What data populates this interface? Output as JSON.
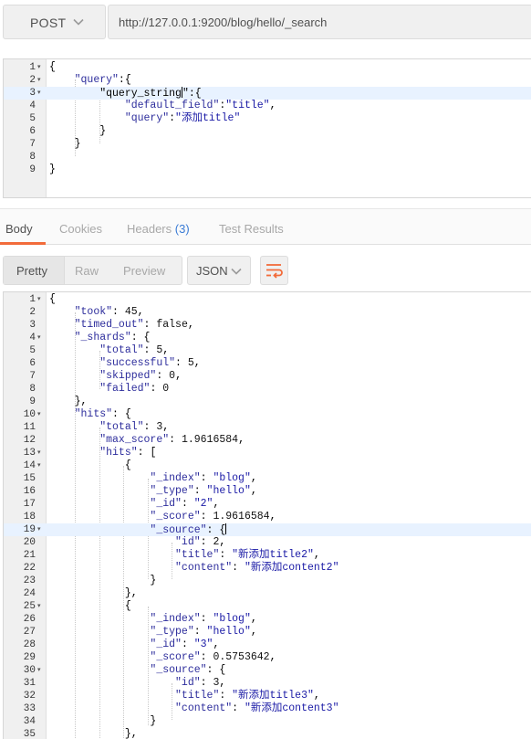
{
  "request": {
    "method": "POST",
    "url": "http://127.0.0.1:9200/blog/hello/_search"
  },
  "request_body": {
    "lines": [
      {
        "n": "1",
        "fold": "▾",
        "text": "{"
      },
      {
        "n": "2",
        "fold": "▾",
        "text": "    \"query\":{"
      },
      {
        "n": "3",
        "fold": "▾",
        "text": "        \"query_string\":{"
      },
      {
        "n": "4",
        "fold": "",
        "text": "            \"default_field\":\"title\","
      },
      {
        "n": "5",
        "fold": "",
        "text": "            \"query\":\"添加title\""
      },
      {
        "n": "6",
        "fold": "",
        "text": "        }"
      },
      {
        "n": "7",
        "fold": "",
        "text": "    }"
      },
      {
        "n": "8",
        "fold": "",
        "text": ""
      },
      {
        "n": "9",
        "fold": "",
        "text": "}"
      }
    ]
  },
  "response_tabs": [
    {
      "label": "Body"
    },
    {
      "label": "Cookies"
    },
    {
      "label": "Headers",
      "badge": "(3)"
    },
    {
      "label": "Test Results"
    }
  ],
  "view_modes": [
    "Pretty",
    "Raw",
    "Preview"
  ],
  "format": "JSON",
  "response_body": {
    "lines": [
      {
        "n": "1",
        "fold": "▾",
        "text": "{"
      },
      {
        "n": "2",
        "fold": "",
        "text": "    \"took\": 45,"
      },
      {
        "n": "3",
        "fold": "",
        "text": "    \"timed_out\": false,"
      },
      {
        "n": "4",
        "fold": "▾",
        "text": "    \"_shards\": {"
      },
      {
        "n": "5",
        "fold": "",
        "text": "        \"total\": 5,"
      },
      {
        "n": "6",
        "fold": "",
        "text": "        \"successful\": 5,"
      },
      {
        "n": "7",
        "fold": "",
        "text": "        \"skipped\": 0,"
      },
      {
        "n": "8",
        "fold": "",
        "text": "        \"failed\": 0"
      },
      {
        "n": "9",
        "fold": "",
        "text": "    },"
      },
      {
        "n": "10",
        "fold": "▾",
        "text": "    \"hits\": {"
      },
      {
        "n": "11",
        "fold": "",
        "text": "        \"total\": 3,"
      },
      {
        "n": "12",
        "fold": "",
        "text": "        \"max_score\": 1.9616584,"
      },
      {
        "n": "13",
        "fold": "▾",
        "text": "        \"hits\": ["
      },
      {
        "n": "14",
        "fold": "▾",
        "text": "            {"
      },
      {
        "n": "15",
        "fold": "",
        "text": "                \"_index\": \"blog\","
      },
      {
        "n": "16",
        "fold": "",
        "text": "                \"_type\": \"hello\","
      },
      {
        "n": "17",
        "fold": "",
        "text": "                \"_id\": \"2\","
      },
      {
        "n": "18",
        "fold": "",
        "text": "                \"_score\": 1.9616584,"
      },
      {
        "n": "19",
        "fold": "▾",
        "text": "                \"_source\": {"
      },
      {
        "n": "20",
        "fold": "",
        "text": "                    \"id\": 2,"
      },
      {
        "n": "21",
        "fold": "",
        "text": "                    \"title\": \"新添加title2\","
      },
      {
        "n": "22",
        "fold": "",
        "text": "                    \"content\": \"新添加content2\""
      },
      {
        "n": "23",
        "fold": "",
        "text": "                }"
      },
      {
        "n": "24",
        "fold": "",
        "text": "            },"
      },
      {
        "n": "25",
        "fold": "▾",
        "text": "            {"
      },
      {
        "n": "26",
        "fold": "",
        "text": "                \"_index\": \"blog\","
      },
      {
        "n": "27",
        "fold": "",
        "text": "                \"_type\": \"hello\","
      },
      {
        "n": "28",
        "fold": "",
        "text": "                \"_id\": \"3\","
      },
      {
        "n": "29",
        "fold": "",
        "text": "                \"_score\": 0.5753642,"
      },
      {
        "n": "30",
        "fold": "▾",
        "text": "                \"_source\": {"
      },
      {
        "n": "31",
        "fold": "",
        "text": "                    \"id\": 3,"
      },
      {
        "n": "32",
        "fold": "",
        "text": "                    \"title\": \"新添加title3\","
      },
      {
        "n": "33",
        "fold": "",
        "text": "                    \"content\": \"新添加content3\""
      },
      {
        "n": "34",
        "fold": "",
        "text": "                }"
      },
      {
        "n": "35",
        "fold": "",
        "text": "            },"
      }
    ]
  },
  "colors": {
    "accent": "#f26b3a",
    "key": "#2d2d9c",
    "string": "#1a1aa6",
    "badge": "#3a7bd5",
    "highlight_line": "#e8f2ff"
  }
}
